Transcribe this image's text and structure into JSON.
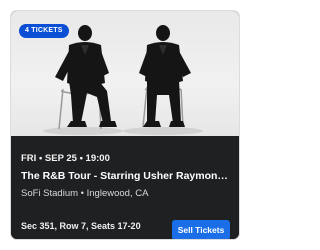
{
  "ticket_card": {
    "badge": "4 TICKETS",
    "date_line": "FRI • SEP 25 • 19:00",
    "title": "The R&B Tour - Starring Usher Raymond & Ne-Yo",
    "venue": "SoFi Stadium • Inglewood, CA",
    "seats": "Sec 351, Row 7, Seats 17-20",
    "sell_button_label": "Sell Tickets",
    "colors": {
      "card_background": "#1f2022",
      "badge": "#0a4fd6",
      "button": "#1a6fe8"
    }
  }
}
